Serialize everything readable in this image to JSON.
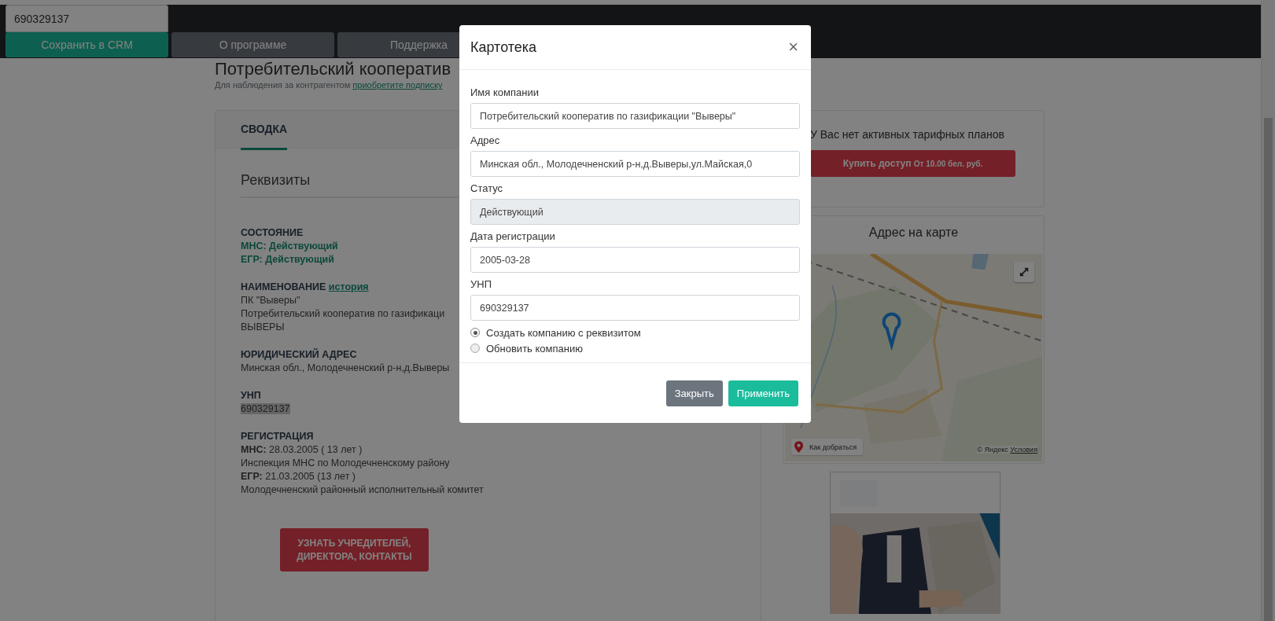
{
  "toolbar": {
    "search_value": "690329137",
    "buttons": [
      {
        "label": "Сохранить в CRM",
        "kind": "primary"
      },
      {
        "label": "О программе",
        "kind": "secondary"
      },
      {
        "label": "Поддержка",
        "kind": "secondary"
      }
    ]
  },
  "page": {
    "title": "Потребительский кооператив",
    "subtitle": "Для наблюдения за контрагентом",
    "subtitle_link": "приобретите подписку"
  },
  "summary": {
    "tabs": [
      {
        "label": "СВОДКА",
        "selected": true
      }
    ],
    "section_title": "Реквизиты",
    "groups": [
      {
        "heading": "СОСТОЯНИЕ",
        "lines": [
          {
            "text": "МНС: Действующий",
            "kind": "status"
          },
          {
            "text": "ЕГР: Действующий",
            "kind": "status"
          }
        ]
      },
      {
        "heading": "НАИМЕНОВАНИЕ",
        "link": "история",
        "lines": [
          {
            "text": "ПК \"Выверы\"",
            "kind": "plain"
          },
          {
            "text": "Потребительский кооператив по газификаци",
            "kind": "plain"
          },
          {
            "text": "ВЫВЕРЫ",
            "kind": "plain"
          }
        ]
      },
      {
        "heading": "ЮРИДИЧЕСКИЙ АДРЕС",
        "lines": [
          {
            "text": "Минская обл., Молодечненский р-н,д.Выверы",
            "kind": "plain"
          }
        ]
      },
      {
        "heading": "УНП",
        "lines": [
          {
            "text": "690329137",
            "kind": "highlight"
          }
        ]
      },
      {
        "heading": "РЕГИСТРАЦИЯ",
        "lines": [
          {
            "text": "**МНС:** 28.03.2005 ( 13 лет )",
            "kind": "plain"
          },
          {
            "text": "Инспекция МНС по Молодечненскому району",
            "kind": "plain"
          },
          {
            "text": "**ЕГР:** 21.03.2005 (13 лет )",
            "kind": "plain"
          },
          {
            "text": "Молодечненский районный исполнительный комитет",
            "kind": "plain"
          }
        ]
      }
    ],
    "cta": "УЗНАТЬ УЧРЕДИТЕЛЕЙ, ДИРЕКТОРА, КОНТАКТЫ"
  },
  "tariff": {
    "message": "У Вас нет активных тарифных планов",
    "buy_button": "Купить доступ",
    "buy_note": "От 10.00 бел. руб."
  },
  "map": {
    "title": "Адрес на карте",
    "route_label": "Как добраться",
    "copyright": "© Яндекс",
    "terms_link": "Условия"
  },
  "modal": {
    "title": "Картотека",
    "close": "×",
    "fields": [
      {
        "label": "Имя компании",
        "value": "Потребительский кооператив по газификации \"Выверы\"",
        "disabled": false
      },
      {
        "label": "Адрес",
        "value": "Минская обл., Молодечненский р-н,д.Выверы,ул.Майская,0",
        "disabled": false
      },
      {
        "label": "Статус",
        "value": "Действующий",
        "disabled": true
      },
      {
        "label": "Дата регистрации",
        "value": "2005-03-28",
        "disabled": false
      },
      {
        "label": "УНП",
        "value": "690329137",
        "disabled": false
      }
    ],
    "options": [
      {
        "label": "Создать компанию с реквизитом",
        "selected": true
      },
      {
        "label": "Обновить компанию",
        "selected": false
      }
    ],
    "buttons": [
      {
        "label": "Закрыть",
        "kind": "secondary"
      },
      {
        "label": "Применить",
        "kind": "primary"
      }
    ]
  }
}
